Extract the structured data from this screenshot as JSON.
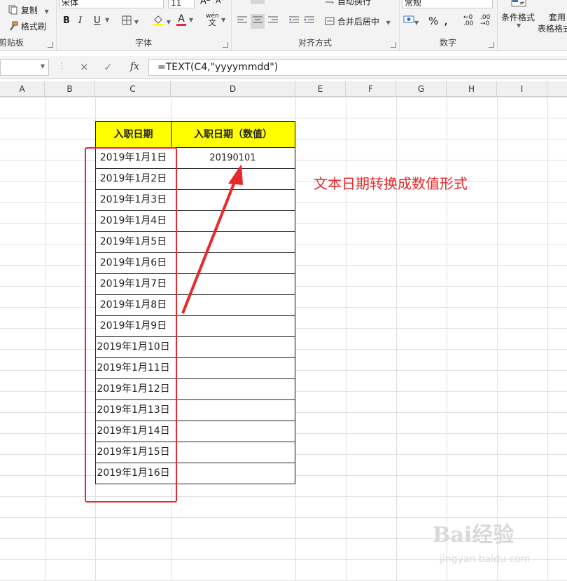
{
  "ribbon": {
    "clipboard": {
      "copy": "复制",
      "format_painter": "格式刷",
      "group": "剪贴板"
    },
    "font": {
      "name": "宋体",
      "size": "11",
      "bold": "B",
      "italic": "I",
      "underline": "U",
      "color_letter": "A",
      "phonetic": "wén",
      "phonetic_char": "文",
      "group": "字体"
    },
    "align": {
      "wrap": "自动换行",
      "merge": "合并后居中",
      "group": "对齐方式"
    },
    "number": {
      "format": "常规",
      "percent": "%",
      "comma": ",",
      "group": "数字"
    },
    "styles": {
      "conditional": "条件格式",
      "table": "套用",
      "table2": "表格格式"
    }
  },
  "formula_bar": {
    "fx": "fx",
    "formula": "=TEXT(C4,\"yyyymmdd\")"
  },
  "columns": [
    "A",
    "B",
    "C",
    "D",
    "E",
    "F",
    "G",
    "H",
    "I"
  ],
  "table": {
    "header_c": "入职日期",
    "header_d": "入职日期（数值）",
    "dates": [
      "2019年1月1日",
      "2019年1月2日",
      "2019年1月3日",
      "2019年1月4日",
      "2019年1月5日",
      "2019年1月6日",
      "2019年1月7日",
      "2019年1月8日",
      "2019年1月9日",
      "2019年1月10日",
      "2019年1月11日",
      "2019年1月12日",
      "2019年1月13日",
      "2019年1月14日",
      "2019年1月15日",
      "2019年1月16日"
    ],
    "values": [
      "20190101",
      "",
      "",
      "",
      "",
      "",
      "",
      "",
      "",
      "",
      "",
      "",
      "",
      "",
      "",
      ""
    ]
  },
  "annotation": "文本日期转换成数值形式",
  "colors": {
    "accent_red": "#e8282b",
    "header_fill": "#ffff00"
  },
  "watermark": {
    "text": "Bai经验",
    "url": "jingyan.baidu.com"
  }
}
